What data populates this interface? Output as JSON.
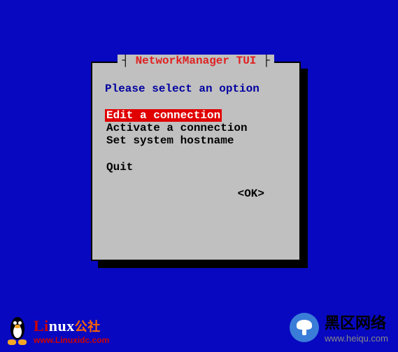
{
  "dialog": {
    "title_segments": {
      "left": "┤ ",
      "right": " ├"
    },
    "title": "NetworkManager TUI",
    "prompt": "Please select an option",
    "menu": [
      {
        "label": "Edit a connection",
        "selected": true
      },
      {
        "label": "Activate a connection",
        "selected": false
      },
      {
        "label": "Set system hostname",
        "selected": false
      }
    ],
    "quit_label": "Quit",
    "ok_label": "<OK>"
  },
  "watermarks": {
    "left": {
      "brand_prefix": "Li",
      "brand_suffix": "nux",
      "brand_cn": "公社",
      "url": "www.Linuxidc.com"
    },
    "right": {
      "brand": "黑区网络",
      "url": "www.heiqu.com"
    }
  }
}
